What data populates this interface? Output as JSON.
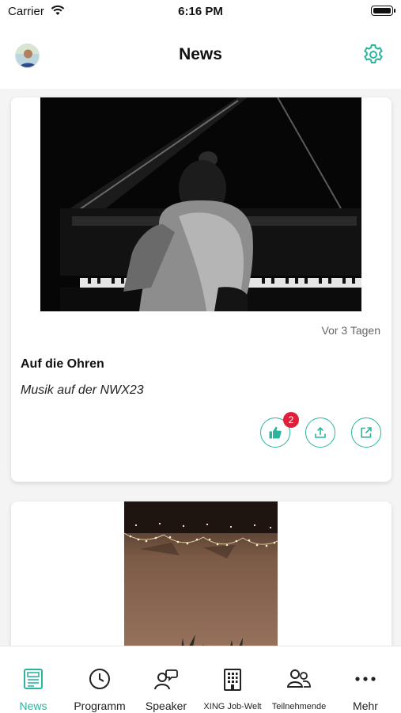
{
  "status_bar": {
    "carrier": "Carrier",
    "time": "6:16 PM"
  },
  "header": {
    "title": "News"
  },
  "colors": {
    "accent": "#2bb59e",
    "badge": "#e0203a"
  },
  "feed": {
    "items": [
      {
        "time_ago": "Vor 3 Tagen",
        "title": "Auf die Ohren",
        "subtitle": "Musik auf der NWX23",
        "like_count": "2",
        "actions": [
          "thumbs-up-icon",
          "share-icon",
          "external-link-icon"
        ]
      }
    ]
  },
  "tabs": [
    {
      "label": "News",
      "icon": "news-icon",
      "active": true
    },
    {
      "label": "Programm",
      "icon": "clock-icon",
      "active": false
    },
    {
      "label": "Speaker",
      "icon": "speaker-icon",
      "active": false
    },
    {
      "label": "XING Job-Welt",
      "icon": "building-icon",
      "active": false
    },
    {
      "label": "Teilnehmende",
      "icon": "people-icon",
      "active": false
    },
    {
      "label": "Mehr",
      "icon": "more-icon",
      "active": false
    }
  ]
}
